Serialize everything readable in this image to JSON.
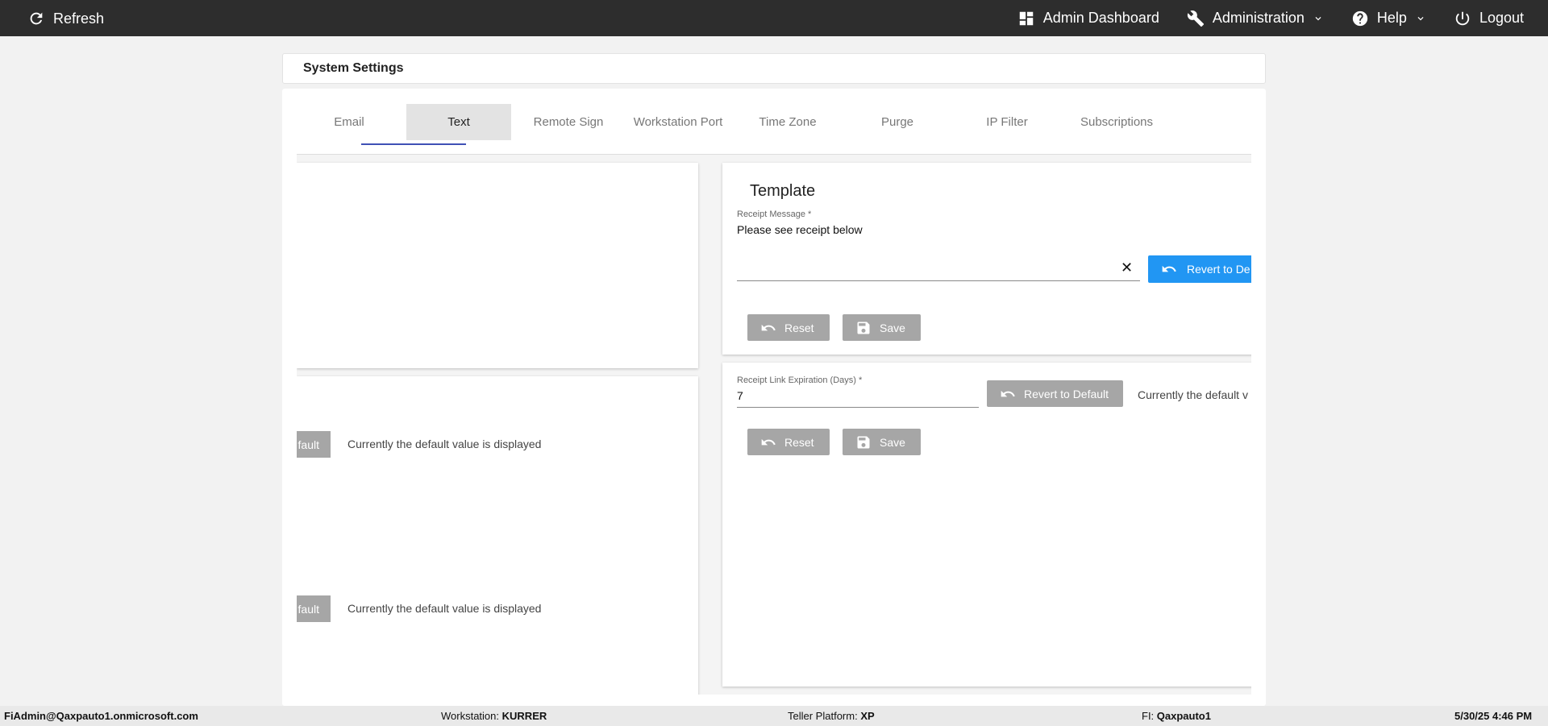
{
  "topbar": {
    "refresh_label": "Refresh",
    "admin_dashboard_label": "Admin Dashboard",
    "administration_label": "Administration",
    "help_label": "Help",
    "logout_label": "Logout"
  },
  "page": {
    "title": "System Settings"
  },
  "tabs": [
    {
      "label": "Email"
    },
    {
      "label": "Text"
    },
    {
      "label": "Remote Sign"
    },
    {
      "label": "Workstation Port"
    },
    {
      "label": "Time Zone"
    },
    {
      "label": "Purge"
    },
    {
      "label": "IP Filter"
    },
    {
      "label": "Subscriptions"
    }
  ],
  "active_tab": "Text",
  "left_panel": {
    "revert_label_fragment_1": "fault",
    "revert_label_fragment_2": "fault",
    "note_1": "Currently the default value is displayed",
    "note_2": "Currently the default value is displayed"
  },
  "template_panel": {
    "title": "Template",
    "receipt_message_label": "Receipt Message *",
    "receipt_message_value": "Please see receipt below",
    "revert_label": "Revert to De",
    "reset_label": "Reset",
    "save_label": "Save"
  },
  "expiration_panel": {
    "label": "Receipt Link Expiration (Days) *",
    "value": "7",
    "revert_label": "Revert to Default",
    "note": "Currently the default v",
    "reset_label": "Reset",
    "save_label": "Save"
  },
  "statusbar": {
    "user": "FiAdmin@Qaxpauto1.onmicrosoft.com",
    "workstation_label": "Workstation:",
    "workstation_value": "KURRER",
    "teller_label": "Teller Platform:",
    "teller_value": "XP",
    "fi_label": "FI:",
    "fi_value": "Qaxpauto1",
    "datetime": "5/30/25 4:46 PM"
  },
  "colors": {
    "topbar": "#2d2d2d",
    "accent_blue": "#2196f3",
    "tab_underline": "#3f51b5",
    "button_gray": "#a6a6a6"
  }
}
